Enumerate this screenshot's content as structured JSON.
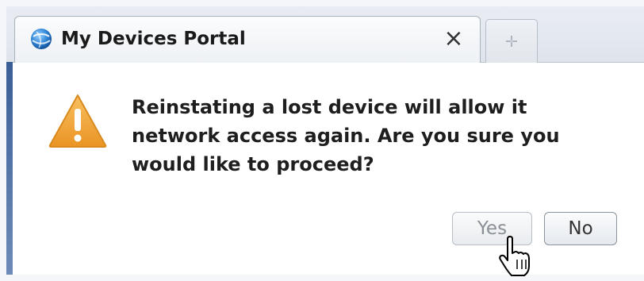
{
  "tab": {
    "title": "My Devices Portal",
    "close_label": "×",
    "icon": "globe-icon"
  },
  "new_tab": {
    "icon": "new-tab-icon"
  },
  "dialog": {
    "icon": "warning-icon",
    "message": "Reinstating a lost device will allow it network access again. Are you sure you would like to proceed?",
    "yes_label": "Yes",
    "no_label": "No"
  },
  "colors": {
    "warning": "#f0a533",
    "accent": "#3a5f96"
  }
}
